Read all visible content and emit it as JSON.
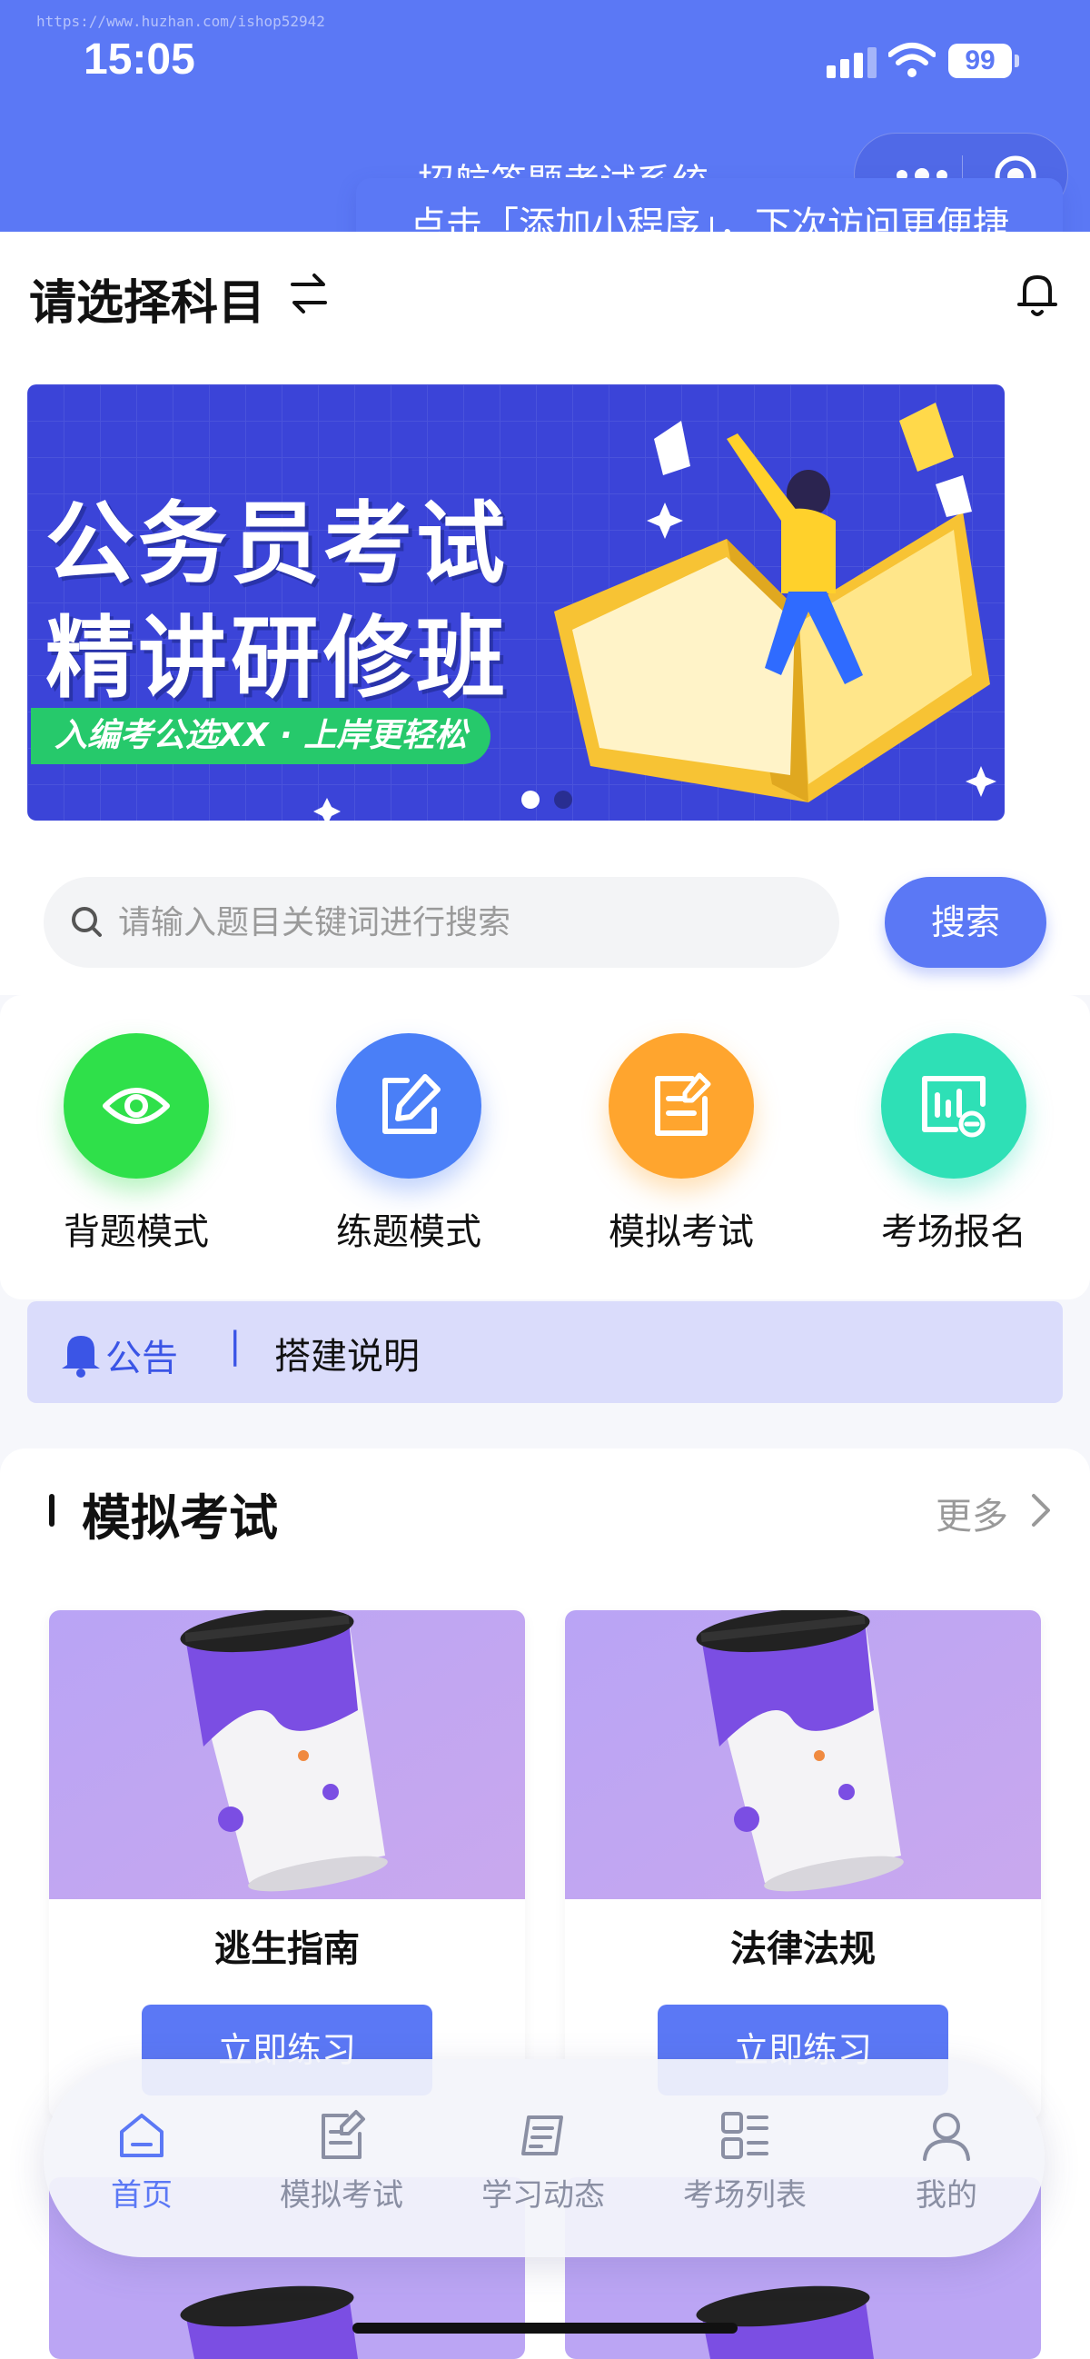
{
  "status_bar": {
    "watermark": "https://www.huzhan.com/ishop52942",
    "time": "15:05",
    "battery": "99"
  },
  "header": {
    "title": "招航答题考试系统",
    "tooltip": "点击「添加小程序」，下次访问更便捷"
  },
  "subject": {
    "label": "请选择科目"
  },
  "banner": {
    "line1": "公务员考试",
    "line2": "精讲研修班",
    "tag": "入编考公选XX · 上岸更轻松",
    "slide_index": 1,
    "slide_count": 2
  },
  "search": {
    "placeholder": "请输入题目关键词进行搜索",
    "button_label": "搜索"
  },
  "quick_entries": [
    {
      "label": "背题模式",
      "icon": "eye-icon",
      "color": "#2fe04a"
    },
    {
      "label": "练题模式",
      "icon": "edit-icon",
      "color": "#4a7ff7"
    },
    {
      "label": "模拟考试",
      "icon": "exam-paper-icon",
      "color": "#ffa52e"
    },
    {
      "label": "考场报名",
      "icon": "chart-board-icon",
      "color": "#2ee0b6"
    }
  ],
  "notice": {
    "title": "公告",
    "separator": "|",
    "text": "搭建说明"
  },
  "exam_section": {
    "title": "模拟考试",
    "more_label": "更多",
    "cards": [
      {
        "name": "逃生指南",
        "button_label": "立即练习"
      },
      {
        "name": "法律法规",
        "button_label": "立即练习"
      }
    ]
  },
  "tabbar": {
    "tabs": [
      {
        "label": "首页",
        "icon": "home-icon",
        "active": true
      },
      {
        "label": "模拟考试",
        "icon": "exam-edit-icon",
        "active": false
      },
      {
        "label": "学习动态",
        "icon": "news-icon",
        "active": false
      },
      {
        "label": "考场列表",
        "icon": "list-grid-icon",
        "active": false
      },
      {
        "label": "我的",
        "icon": "user-icon",
        "active": false
      }
    ]
  },
  "colors": {
    "primary": "#5b78f5",
    "notice_bg": "#dadcfb",
    "banner_bg": "#3b44d8",
    "banner_tag": "#26c96b"
  }
}
